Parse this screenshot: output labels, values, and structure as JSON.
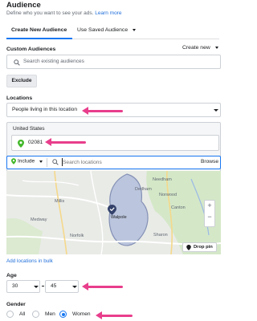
{
  "header": {
    "title": "Audience",
    "subtitle": "Define who you want to see your ads.",
    "learn_more": "Learn more"
  },
  "tabs": [
    {
      "label": "Create New Audience",
      "active": true
    },
    {
      "label": "Use Saved Audience",
      "active": false
    }
  ],
  "custom_audiences": {
    "label": "Custom Audiences",
    "create_new": "Create new",
    "search_placeholder": "Search existing audiences",
    "exclude_button": "Exclude"
  },
  "locations": {
    "label": "Locations",
    "type_value": "People living in this location",
    "country": "United States",
    "zip_code": "02081",
    "include_label": "Include",
    "search_placeholder": "Search locations",
    "browse": "Browse",
    "add_bulk": "Add locations in bulk"
  },
  "map": {
    "places": [
      "Needham",
      "Dedham",
      "Norwood",
      "Millis",
      "Walpole",
      "Canton",
      "Medway",
      "Norfolk",
      "Sharon"
    ],
    "drop_pin": "Drop pin",
    "zoom_in": "+",
    "zoom_out": "−"
  },
  "age": {
    "label": "Age",
    "min": "30",
    "max": "45"
  },
  "gender": {
    "label": "Gender",
    "options": [
      "All",
      "Men",
      "Women"
    ],
    "selected": "Women"
  },
  "colors": {
    "accent": "#1877f2",
    "link": "#216fdb",
    "annotation_arrow": "#e83e8c",
    "pin_green": "#42b72a",
    "radius_fill": "#b9c3dd"
  }
}
